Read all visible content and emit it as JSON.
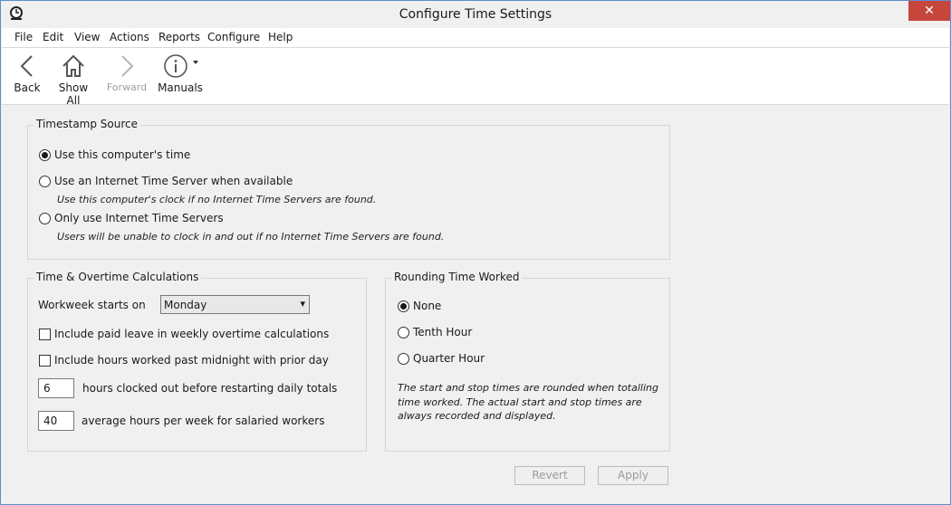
{
  "window": {
    "title": "Configure Time Settings",
    "close_glyph": "✕"
  },
  "menu": [
    "File",
    "Edit",
    "View",
    "Actions",
    "Reports",
    "Configure",
    "Help"
  ],
  "toolbar": {
    "back": "Back",
    "show_all": "Show All",
    "forward": "Forward",
    "manuals": "Manuals"
  },
  "timestamp_source": {
    "title": "Timestamp Source",
    "options": [
      {
        "label": "Use this computer's time",
        "selected": true
      },
      {
        "label": "Use an Internet Time Server when available",
        "selected": false
      },
      {
        "label": "Only use Internet Time Servers",
        "selected": false
      }
    ],
    "hints": [
      "Use this computer's clock if no Internet Time Servers are found.",
      "Users will be unable to clock in and out if no Internet Time Servers are found."
    ]
  },
  "overtime": {
    "title": "Time & Overtime Calculations",
    "workweek_label": "Workweek starts on",
    "workweek_value": "Monday",
    "checks": [
      {
        "label": "Include paid leave in weekly overtime calculations",
        "checked": false
      },
      {
        "label": "Include hours worked past midnight with prior day",
        "checked": false
      }
    ],
    "clocked_out_value": "6",
    "clocked_out_label": "hours clocked out before restarting daily totals",
    "avg_hours_value": "40",
    "avg_hours_label": "average hours per week for salaried workers"
  },
  "rounding": {
    "title": "Rounding Time Worked",
    "options": [
      {
        "label": "None",
        "selected": true
      },
      {
        "label": "Tenth Hour",
        "selected": false
      },
      {
        "label": "Quarter Hour",
        "selected": false
      }
    ],
    "note": "The start and stop times are rounded when totalling time worked. The actual start and stop times are always recorded and displayed."
  },
  "buttons": {
    "revert": "Revert",
    "apply": "Apply"
  }
}
